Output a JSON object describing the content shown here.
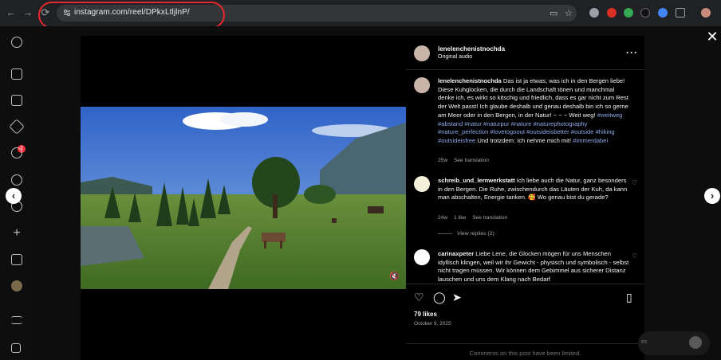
{
  "browser": {
    "url": "instagram.com/reel/DPkxLtljlnP/",
    "nav": {
      "back": "←",
      "forward": "→",
      "reload": "⟳"
    },
    "extensions": [
      {
        "name": "globe-icon",
        "color": "#9aa0a6"
      },
      {
        "name": "ext-red-icon",
        "color": "#d93025"
      },
      {
        "name": "ext-green-icon",
        "color": "#34a853"
      },
      {
        "name": "ext-dark-icon",
        "color": "#111111"
      },
      {
        "name": "ext-blue-icon",
        "color": "#4285f4"
      },
      {
        "name": "puzzle-icon",
        "color": "#9aa0a6"
      }
    ]
  },
  "rail": {
    "notifications_badge": "2"
  },
  "post": {
    "author": "lenelenchenistnochda",
    "audio": "Original audio",
    "more": "···",
    "caption_author": "lenelenchenistnochda",
    "caption_text": "Das ist ja etwas, was ich in den Bergen liebe! Diese Kuhglocken, die durch die Landschaft tönen und manchmal denke ich, es wirkt so kitschig und friedlich, dass es gar nicht zum Rest der Welt passt! Ich glaube deshalb und genau deshalb bin ich so gerne am Meer oder in den Bergen, in der Natur! ~ ~ ~ Weit weg!",
    "caption_tags": "#weitweg #abstand #natur #naturpur #nature #naturephotography #nature_perfection #lovetogoout #outsideisbetter #outside #hiking #outsideisfree",
    "caption_text2": "Und trotzdem: Ich nehme mich mit!",
    "caption_tags2": "#immerdabei",
    "caption_meta": {
      "age": "25w",
      "translate": "See translation"
    },
    "likes": "79 likes",
    "date": "October 9, 2025",
    "limited": "Comments on this post have been limited."
  },
  "comments": [
    {
      "author": "schreib_und_lernwerkstatt",
      "text": "Ich liebe auch die Natur, ganz besonders in den Bergen. Die Ruhe, zwischendurch das Läuten der Kuh, da kann man abschalten, Energie tanken. 🥰 Wo genau bist du gerade?",
      "age": "24w",
      "likes": "1 like",
      "translate": "See translation",
      "replies": "View replies (2)"
    },
    {
      "author": "carinaxpeter",
      "text": "Liebe Lene, die Glocken mögen für uns Menschen idyllisch klingen, weil wir ihr Gewicht - physisch und symbolisch - selbst nicht tragen müssen. Wir können dem Gebimmel aus sicherer Distanz lauschen und uns dem Klang nach Bedarf"
    }
  ],
  "messages_hint": "es",
  "colors": {
    "accent_red": "#e5282d",
    "hashtag": "#8fa8e8",
    "badge": "#ff3040"
  }
}
